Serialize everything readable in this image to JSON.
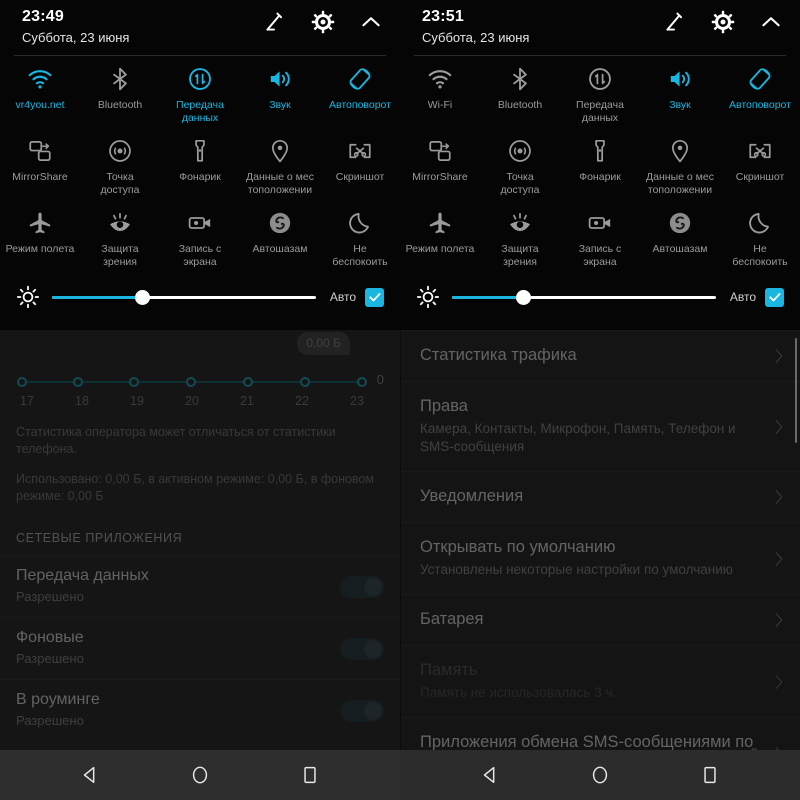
{
  "panels": [
    {
      "id": "left",
      "statusbar": {
        "time": "23:49",
        "date": "Суббота, 23 июня"
      },
      "header_actions": [
        {
          "name": "edit-icon",
          "label": "Изменить"
        },
        {
          "name": "gear-icon",
          "label": "Настройки"
        },
        {
          "name": "chevron-up-icon",
          "label": "Свернуть"
        }
      ],
      "tiles": [
        {
          "label": "vr4you.net",
          "icon": "wifi-icon",
          "on": true
        },
        {
          "label": "Bluetooth",
          "icon": "bluetooth-icon",
          "on": false
        },
        {
          "label": "Передача данных",
          "icon": "data-transfer-icon",
          "on": true
        },
        {
          "label": "Звук",
          "icon": "sound-icon",
          "on": true
        },
        {
          "label": "Автоповорот",
          "icon": "autorotate-icon",
          "on": true
        },
        {
          "label": "MirrorShare",
          "icon": "mirrorshare-icon",
          "on": false
        },
        {
          "label": "Точка доступа",
          "icon": "hotspot-icon",
          "on": false
        },
        {
          "label": "Фонарик",
          "icon": "flashlight-icon",
          "on": false
        },
        {
          "label": "Данные о местоположении",
          "icon": "location-pin-icon",
          "on": false
        },
        {
          "label": "Скриншот",
          "icon": "screenshot-icon",
          "on": false
        },
        {
          "label": "Режим полета",
          "icon": "airplane-icon",
          "on": false
        },
        {
          "label": "Защита зрения",
          "icon": "eye-protect-icon",
          "on": false
        },
        {
          "label": "Запись с экрана",
          "icon": "screen-record-icon",
          "on": false
        },
        {
          "label": "Автошазам",
          "icon": "shazam-icon",
          "on": false
        },
        {
          "label": "Не беспокоить",
          "icon": "moon-icon",
          "on": false
        }
      ],
      "brightness": {
        "icon": "brightness-icon",
        "percent": 34,
        "auto_label": "Авто",
        "auto_checked": true
      }
    },
    {
      "id": "right",
      "statusbar": {
        "time": "23:51",
        "date": "Суббота, 23 июня"
      },
      "header_actions": [
        {
          "name": "edit-icon",
          "label": "Изменить"
        },
        {
          "name": "gear-icon",
          "label": "Настройки"
        },
        {
          "name": "chevron-up-icon",
          "label": "Свернуть"
        }
      ],
      "tiles": [
        {
          "label": "Wi-Fi",
          "icon": "wifi-icon",
          "on": false
        },
        {
          "label": "Bluetooth",
          "icon": "bluetooth-icon",
          "on": false
        },
        {
          "label": "Передача данных",
          "icon": "data-transfer-icon",
          "on": false
        },
        {
          "label": "Звук",
          "icon": "sound-icon",
          "on": true
        },
        {
          "label": "Автоповорот",
          "icon": "autorotate-icon",
          "on": true
        },
        {
          "label": "MirrorShare",
          "icon": "mirrorshare-icon",
          "on": false
        },
        {
          "label": "Точка доступа",
          "icon": "hotspot-icon",
          "on": false
        },
        {
          "label": "Фонарик",
          "icon": "flashlight-icon",
          "on": false
        },
        {
          "label": "Данные о местоположении",
          "icon": "location-pin-icon",
          "on": false
        },
        {
          "label": "Скриншот",
          "icon": "screenshot-icon",
          "on": false
        },
        {
          "label": "Режим полета",
          "icon": "airplane-icon",
          "on": false
        },
        {
          "label": "Защита зрения",
          "icon": "eye-protect-icon",
          "on": false
        },
        {
          "label": "Запись с экрана",
          "icon": "screen-record-icon",
          "on": false
        },
        {
          "label": "Автошазам",
          "icon": "shazam-icon",
          "on": false
        },
        {
          "label": "Не беспокоить",
          "icon": "moon-icon",
          "on": false
        }
      ],
      "brightness": {
        "icon": "brightness-icon",
        "percent": 27,
        "auto_label": "Авто",
        "auto_checked": true
      }
    }
  ],
  "tile_labels": {
    "row1": [
      "vr4you.net",
      "Bluetooth",
      "Передача\nданных",
      "Звук",
      "Автоповорот"
    ],
    "row1_right": [
      "Wi-Fi",
      "Bluetooth",
      "Передача\nданных",
      "Звук",
      "Автоповорот"
    ],
    "row2": [
      "MirrorShare",
      "Точка\nдоступа",
      "Фонарик",
      "Данные о мес\nтоположении",
      "Скриншот"
    ],
    "row3": [
      "Режим полета",
      "Защита\nзрения",
      "Запись с\nэкрана",
      "Автошазам",
      "Не\nбеспокоить"
    ]
  },
  "left_app": {
    "bubble_value": "0,00 Б",
    "zero_label": "0",
    "note_1": "Статистика оператора может отличаться от статистики телефона.",
    "note_2": "Использовано: 0,00 Б, в активном режиме: 0,00 Б, в фоновом режиме: 0,00 Б",
    "section_header": "СЕТЕВЫЕ ПРИЛОЖЕНИЯ",
    "rows": [
      {
        "title": "Передача данных",
        "sub": "Разрешено",
        "switch": "on"
      },
      {
        "title": "Фоновые",
        "sub": "Разрешено",
        "switch": "on"
      },
      {
        "title": "В роуминге",
        "sub": "Разрешено",
        "switch": "on"
      }
    ]
  },
  "chart_data": {
    "type": "line",
    "title": "",
    "xlabel": "",
    "ylabel": "",
    "categories": [
      "17",
      "18",
      "19",
      "20",
      "21",
      "22",
      "23"
    ],
    "x": [
      17,
      18,
      19,
      20,
      21,
      22,
      23
    ],
    "values": [
      0,
      0,
      0,
      0,
      0,
      0,
      0
    ],
    "ylim": [
      0,
      0
    ],
    "y_ticks": [
      "0"
    ],
    "annotation": "0,00 Б",
    "grid": false,
    "legend": "none",
    "unit": "Б",
    "series": [
      {
        "name": "Использовано",
        "values": [
          0,
          0,
          0,
          0,
          0,
          0,
          0
        ]
      }
    ]
  },
  "right_app": {
    "rows": [
      {
        "title": "Статистика трафика",
        "sub": "",
        "value": "",
        "dim": false
      },
      {
        "title": "Права",
        "sub": "Камера, Контакты, Микрофон, Память, Телефон и SMS-сообщения",
        "value": "",
        "dim": false
      },
      {
        "title": "Уведомления",
        "sub": "",
        "value": "",
        "dim": false
      },
      {
        "title": "Открывать по умолчанию",
        "sub": "Установлены некоторые настройки по умолчанию",
        "value": "",
        "dim": false
      },
      {
        "title": "Батарея",
        "sub": "",
        "value": "",
        "dim": false
      },
      {
        "title": "Память",
        "sub": "Память не использовалась 3 ч.",
        "value": "",
        "dim": true
      },
      {
        "title": "Приложения обмена SMS-сообщениями по умолчанию",
        "sub": "",
        "value": "Да",
        "dim": false
      }
    ]
  },
  "navbar": {
    "buttons": [
      {
        "name": "back-button",
        "icon": "triangle-back-icon"
      },
      {
        "name": "home-button",
        "icon": "circle-home-icon"
      },
      {
        "name": "recents-button",
        "icon": "square-recents-icon"
      }
    ]
  },
  "colors": {
    "accent": "#18b6e0",
    "panel_bg": "#050506",
    "app_bg": "#2f2f2f",
    "nav_bg": "#2e2e2e",
    "text_primary": "#ffffff",
    "text_secondary": "#9b9b9b"
  }
}
